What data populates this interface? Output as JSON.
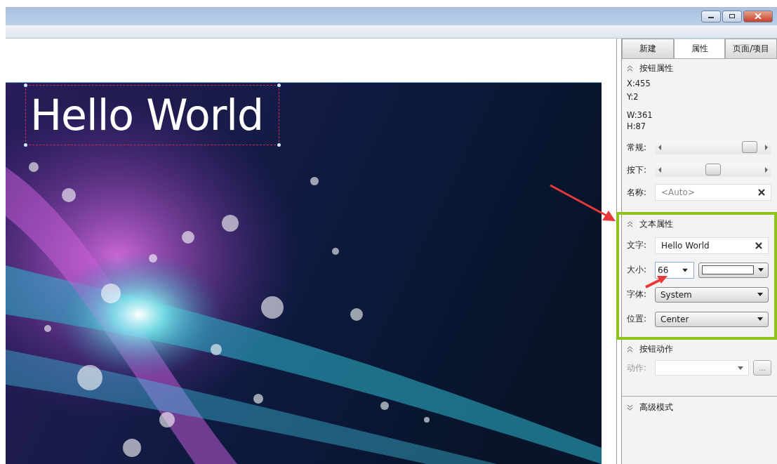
{
  "tabs": [
    {
      "label": "新建",
      "selected": false
    },
    {
      "label": "属性",
      "selected": true
    },
    {
      "label": "页面/项目",
      "selected": false
    }
  ],
  "button_properties": {
    "header": "按钮属性",
    "expanded": true,
    "x": "X:455",
    "y": "Y:2",
    "w": "W:361",
    "h": "H:87",
    "sliders": [
      {
        "label": "常规:",
        "level": 0.88
      },
      {
        "label": "按下:",
        "level": 0.5
      }
    ],
    "name": {
      "label": "名称:",
      "placeholder": "<Auto>"
    }
  },
  "text_properties": {
    "header": "文本属性",
    "expanded": true,
    "highlighted": true,
    "text": {
      "label": "文字:",
      "value": "Hello World"
    },
    "size": {
      "label": "大小:",
      "value": "66"
    },
    "font": {
      "label": "字体:",
      "value": "System"
    },
    "position": {
      "label": "位置:",
      "value": "Center"
    }
  },
  "button_action": {
    "header": "按钮动作",
    "expanded": true,
    "action": {
      "label": "动作:",
      "disabled": true,
      "button": "..."
    }
  },
  "advanced": {
    "header": "高级模式",
    "expanded": false
  },
  "canvas": {
    "text": "Hello World",
    "selected": true
  }
}
